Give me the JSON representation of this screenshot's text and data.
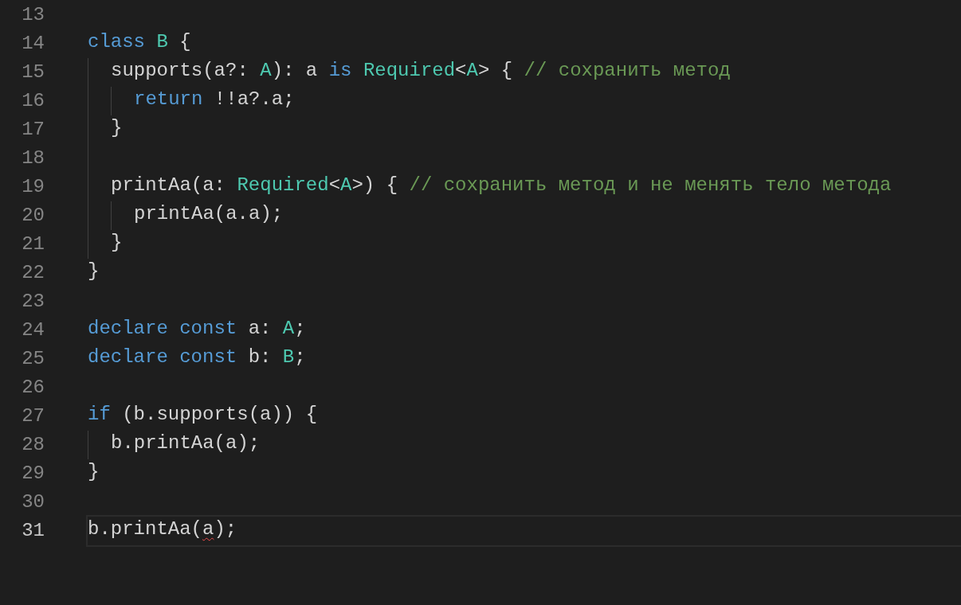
{
  "editor": {
    "lines": [
      {
        "number": "13",
        "current": false
      },
      {
        "number": "14",
        "current": false,
        "tokens": [
          {
            "text": "class ",
            "kind": "keyword"
          },
          {
            "text": "B",
            "kind": "type"
          },
          {
            "text": " {",
            "kind": "plain"
          }
        ]
      },
      {
        "number": "15",
        "current": false,
        "tokens": [
          {
            "text": "  supports(a?: ",
            "kind": "plain"
          },
          {
            "text": "A",
            "kind": "type"
          },
          {
            "text": "): a ",
            "kind": "plain"
          },
          {
            "text": "is ",
            "kind": "keyword"
          },
          {
            "text": "Required",
            "kind": "type"
          },
          {
            "text": "<",
            "kind": "plain"
          },
          {
            "text": "A",
            "kind": "type"
          },
          {
            "text": "> { ",
            "kind": "plain"
          },
          {
            "text": "// сохранить метод",
            "kind": "comment"
          }
        ]
      },
      {
        "number": "16",
        "current": false,
        "tokens": [
          {
            "text": "    return",
            "kind": "keyword"
          },
          {
            "text": " !!a?.a;",
            "kind": "plain"
          }
        ]
      },
      {
        "number": "17",
        "current": false,
        "tokens": [
          {
            "text": "  }",
            "kind": "plain"
          }
        ]
      },
      {
        "number": "18",
        "current": false
      },
      {
        "number": "19",
        "current": false,
        "tokens": [
          {
            "text": "  printAa(a: ",
            "kind": "plain"
          },
          {
            "text": "Required",
            "kind": "type"
          },
          {
            "text": "<",
            "kind": "plain"
          },
          {
            "text": "A",
            "kind": "type"
          },
          {
            "text": ">) { ",
            "kind": "plain"
          },
          {
            "text": "// сохранить метод и не менять тело метода",
            "kind": "comment"
          }
        ]
      },
      {
        "number": "20",
        "current": false,
        "tokens": [
          {
            "text": "    printAa(a.a);",
            "kind": "plain"
          }
        ]
      },
      {
        "number": "21",
        "current": false,
        "tokens": [
          {
            "text": "  }",
            "kind": "plain"
          }
        ]
      },
      {
        "number": "22",
        "current": false,
        "tokens": [
          {
            "text": "}",
            "kind": "plain"
          }
        ]
      },
      {
        "number": "23",
        "current": false
      },
      {
        "number": "24",
        "current": false,
        "tokens": [
          {
            "text": "declare const",
            "kind": "keyword"
          },
          {
            "text": " a: ",
            "kind": "plain"
          },
          {
            "text": "A",
            "kind": "type"
          },
          {
            "text": ";",
            "kind": "plain"
          }
        ]
      },
      {
        "number": "25",
        "current": false,
        "tokens": [
          {
            "text": "declare const",
            "kind": "keyword"
          },
          {
            "text": " b: ",
            "kind": "plain"
          },
          {
            "text": "B",
            "kind": "type"
          },
          {
            "text": ";",
            "kind": "plain"
          }
        ]
      },
      {
        "number": "26",
        "current": false
      },
      {
        "number": "27",
        "current": false,
        "tokens": [
          {
            "text": "if",
            "kind": "keyword"
          },
          {
            "text": " (b.supports(a)) {",
            "kind": "plain"
          }
        ]
      },
      {
        "number": "28",
        "current": false,
        "tokens": [
          {
            "text": "  b.printAa(a);",
            "kind": "plain"
          }
        ]
      },
      {
        "number": "29",
        "current": false,
        "tokens": [
          {
            "text": "}",
            "kind": "plain"
          }
        ]
      },
      {
        "number": "30",
        "current": false
      },
      {
        "number": "31",
        "current": true,
        "tokens": [
          {
            "text": "b.printAa(",
            "kind": "plain"
          },
          {
            "text": "a",
            "kind": "error"
          },
          {
            "text": ");",
            "kind": "plain"
          }
        ]
      }
    ]
  }
}
